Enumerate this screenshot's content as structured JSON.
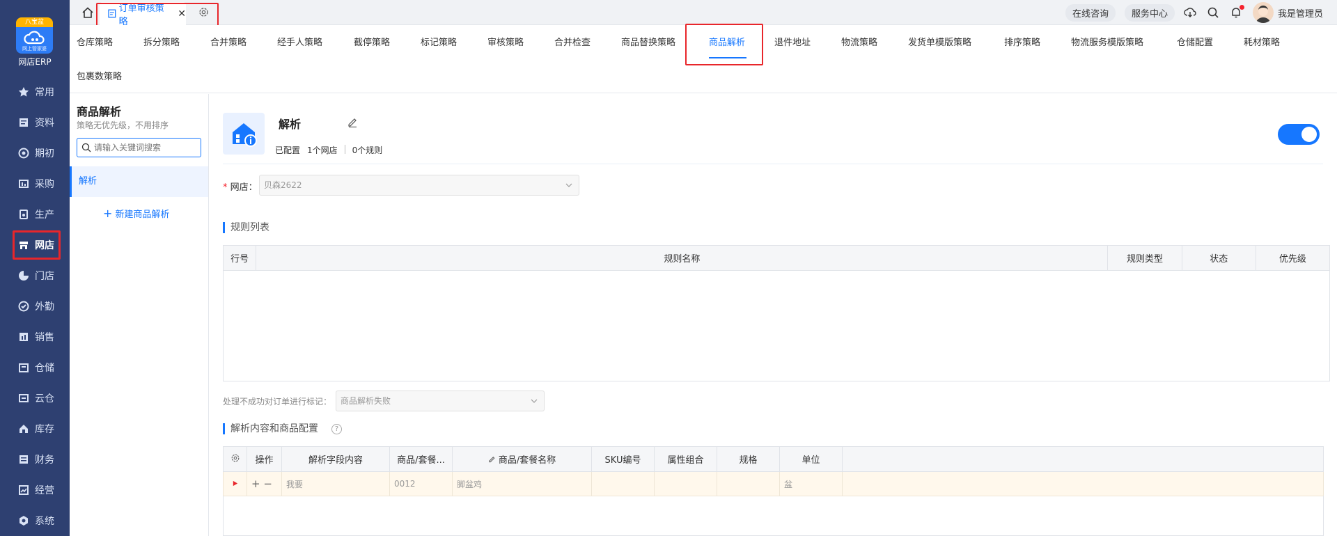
{
  "app": {
    "logo_ribbon": "八宝盆",
    "logo_sub": "网上管家婆",
    "name": "网店ERP"
  },
  "sidebar": {
    "items": [
      {
        "label": "常用",
        "icon": "star-icon"
      },
      {
        "label": "资料",
        "icon": "document-icon"
      },
      {
        "label": "期初",
        "icon": "target-icon"
      },
      {
        "label": "采购",
        "icon": "purchase-icon"
      },
      {
        "label": "生产",
        "icon": "production-icon"
      },
      {
        "label": "网店",
        "icon": "store-icon"
      },
      {
        "label": "门店",
        "icon": "pie-icon"
      },
      {
        "label": "外勤",
        "icon": "field-icon"
      },
      {
        "label": "销售",
        "icon": "chart-icon"
      },
      {
        "label": "仓储",
        "icon": "warehouse-icon"
      },
      {
        "label": "云仓",
        "icon": "cloud-warehouse-icon"
      },
      {
        "label": "库存",
        "icon": "home-icon"
      },
      {
        "label": "财务",
        "icon": "finance-icon"
      },
      {
        "label": "经营",
        "icon": "business-icon"
      },
      {
        "label": "系统",
        "icon": "settings-icon"
      }
    ]
  },
  "topbar": {
    "active_tab": "订单审核策略",
    "close_glyph": "✕",
    "consult": "在线咨询",
    "service": "服务中心",
    "user": "我是管理员"
  },
  "strategy_tabs": [
    "仓库策略",
    "拆分策略",
    "合并策略",
    "经手人策略",
    "截停策略",
    "标记策略",
    "审核策略",
    "合并检查",
    "商品替换策略",
    "商品解析",
    "退件地址",
    "物流策略",
    "发货单模版策略",
    "排序策略",
    "物流服务模版策略",
    "仓储配置",
    "耗材策略",
    "包裹数策略"
  ],
  "left_panel": {
    "title": "商品解析",
    "subtitle": "策略无优先级，不用排序",
    "search_placeholder": "请输入关键词搜索",
    "item": "解析",
    "new_label": "新建商品解析"
  },
  "header": {
    "title": "解析",
    "configured": "已配置",
    "stores": "1个网店",
    "rules": "0个规则",
    "enabled": true
  },
  "form": {
    "store_label": "网店：",
    "store_value": "贝森2622",
    "fail_mark_label": "处理不成功对订单进行标记：",
    "fail_mark_value": "商品解析失败"
  },
  "rules": {
    "section_title": "规则列表",
    "columns": [
      "行号",
      "规则名称",
      "规则类型",
      "状态",
      "优先级"
    ]
  },
  "config": {
    "section_title": "解析内容和商品配置",
    "help_glyph": "?",
    "columns": [
      "操作",
      "解析字段内容",
      "商品/套餐...",
      "商品/套餐名称",
      "SKU编号",
      "属性组合",
      "规格",
      "单位"
    ],
    "row": {
      "parse_content": "我要",
      "code": "0012",
      "name": "脚盆鸡",
      "sku": "",
      "attrs": "",
      "spec": "",
      "unit": "盆",
      "add_glyph": "+",
      "remove_glyph": "−"
    }
  },
  "colors": {
    "sidebar_bg": "#2e4071",
    "accent": "#1677ff",
    "highlight_box": "#e8262b"
  }
}
